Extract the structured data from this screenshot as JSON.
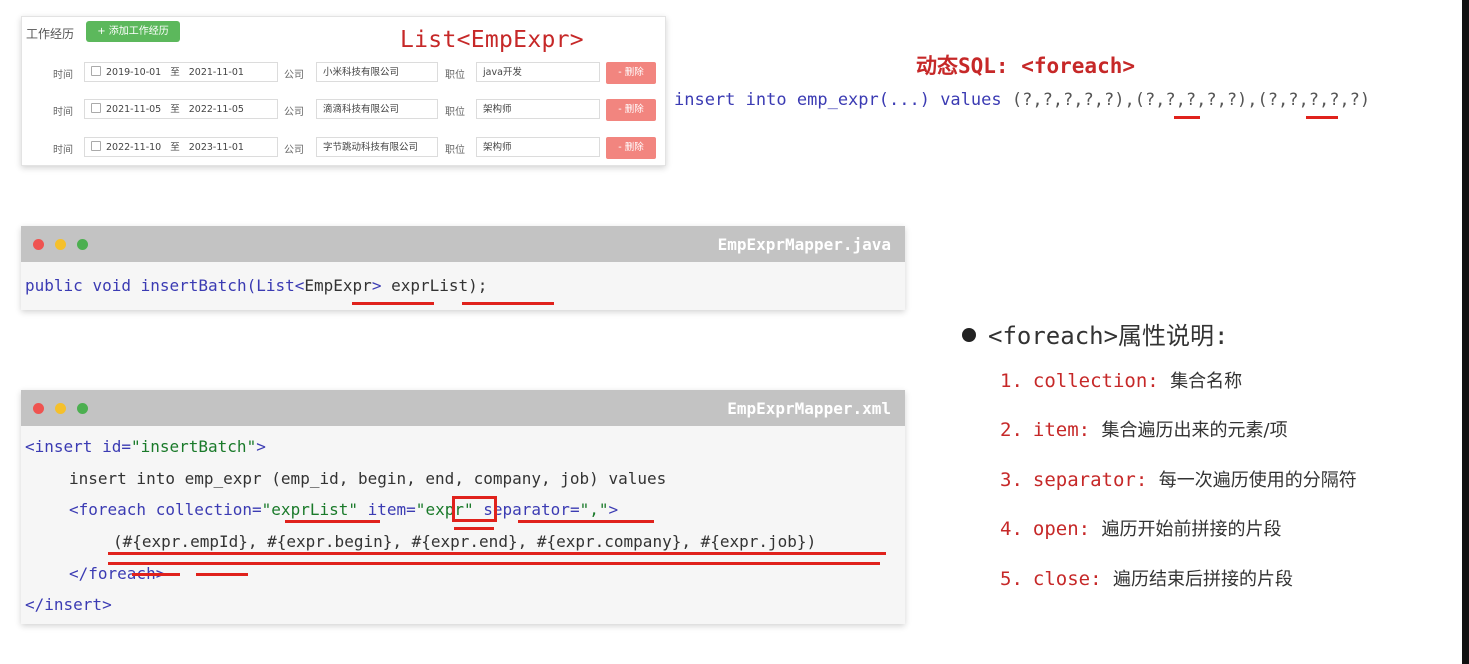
{
  "form": {
    "section_label": "工作经历",
    "add_button": "+ 添加工作经历",
    "list_title": "List<EmpExpr>",
    "time_label": "时间",
    "to_label": "至",
    "company_label": "公司",
    "job_label": "职位",
    "delete_label": "- 删除",
    "rows": [
      {
        "begin": "2019-10-01",
        "end": "2021-11-01",
        "company": "小米科技有限公司",
        "job": "java开发"
      },
      {
        "begin": "2021-11-05",
        "end": "2022-11-05",
        "company": "滴滴科技有限公司",
        "job": "架构师"
      },
      {
        "begin": "2022-11-10",
        "end": "2023-11-01",
        "company": "字节跳动科技有限公司",
        "job": "架构师"
      }
    ]
  },
  "dynamic_sql": {
    "title": "动态SQL: <foreach>",
    "kw_insert": "insert",
    "kw_into": "into",
    "table": "emp_expr(...)",
    "kw_values": "values",
    "group1": "(?,?,?,?,?)",
    "sep1": ",",
    "group2": "(?,?,?,?,?)",
    "sep2": ",",
    "group3": "(?,?,?,?,?)"
  },
  "mapper_java": {
    "filename": "EmpExprMapper.java",
    "kw_public": "public",
    "kw_void": "void",
    "method": "insertBatch(List<",
    "type": "EmpExpr",
    "close_type": ">",
    "param": "exprList",
    "end": ");"
  },
  "mapper_xml": {
    "filename": "EmpExprMapper.xml",
    "line1_tag": "<insert id=",
    "line1_val": "\"insertBatch\"",
    "line1_end": ">",
    "line2": "insert into emp_expr (emp_id, begin, end, company, job) values",
    "line3_tag": "<foreach collection=",
    "line3_q1": "\"",
    "line3_coll": "exprList",
    "line3_q2": "\"",
    "line3_item": " item=",
    "line3_q3": "\"",
    "line3_itemval": "expr",
    "line3_q4": "\"",
    "line3_sep": " separator=",
    "line3_sepval": "\",\"",
    "line3_end": ">",
    "line4": "(#{expr.empId}, #{expr.begin}, #{expr.end}, #{expr.company}, #{expr.job})",
    "line5": "</foreach>",
    "line6": "</insert>"
  },
  "foreach_attrs": {
    "title": "<foreach>属性说明:",
    "items": [
      {
        "num": "1.",
        "name": "collection:",
        "desc": "集合名称"
      },
      {
        "num": "2.",
        "name": "item:",
        "desc": "集合遍历出来的元素/项"
      },
      {
        "num": "3.",
        "name": "separator:",
        "desc": "每一次遍历使用的分隔符"
      },
      {
        "num": "4.",
        "name": "open:",
        "desc": "遍历开始前拼接的片段"
      },
      {
        "num": "5.",
        "name": "close:",
        "desc": "遍历结束后拼接的片段"
      }
    ]
  },
  "colors": {
    "accent_red": "#c62828",
    "underline_red": "#e0221c",
    "keyword_blue": "#3b3bb3",
    "string_green": "#1a7a2a",
    "add_green": "#5cb85c",
    "delete_red": "#f2857f"
  }
}
